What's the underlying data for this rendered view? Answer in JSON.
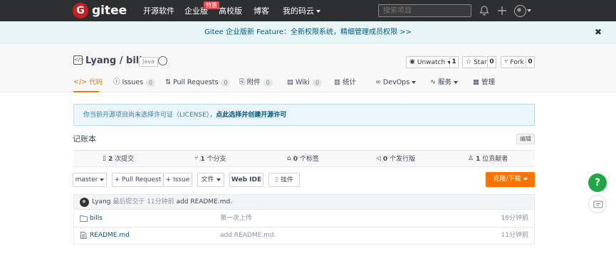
{
  "brand": {
    "logo_letter": "G",
    "name": "gitee"
  },
  "topnav": {
    "items": [
      "开源软件",
      "企业版",
      "高校版",
      "博客",
      "我的码云"
    ],
    "hot_badge": "特惠",
    "search_placeholder": "搜索项目"
  },
  "banner": {
    "text": "Gitee 企业版新 Feature：全新权限系统，精细管理成员权限 >>"
  },
  "repo": {
    "owner": "Lyang",
    "name": "bills",
    "title": "Lyang / bills",
    "language": "Java",
    "actions": [
      {
        "label": "Unwatch",
        "count": "1"
      },
      {
        "label": "Star",
        "count": "0"
      },
      {
        "label": "Fork",
        "count": "0"
      }
    ]
  },
  "tabs": [
    {
      "label": "代码",
      "count": null
    },
    {
      "label": "Issues",
      "count": "0"
    },
    {
      "label": "Pull Requests",
      "count": "0"
    },
    {
      "label": "附件",
      "count": "0"
    },
    {
      "label": "Wiki",
      "count": "0"
    },
    {
      "label": "统计",
      "count": null
    },
    {
      "label": "DevOps",
      "count": null
    },
    {
      "label": "服务",
      "count": null
    },
    {
      "label": "管理",
      "count": null
    }
  ],
  "license": {
    "text": "你当前开源项目尚未选择许可证（LICENSE），",
    "link": "点此选择并创建开源许可"
  },
  "description": "记账本",
  "edit_label": "编辑",
  "stats": [
    {
      "num": "2",
      "label": "次提交"
    },
    {
      "num": "1",
      "label": "个分支"
    },
    {
      "num": "0",
      "label": "个标签"
    },
    {
      "num": "0",
      "label": "个发行版"
    },
    {
      "num": "1",
      "label": "位贡献者"
    }
  ],
  "toolbar": {
    "branch": "master",
    "pull_request": "+ Pull Request",
    "issue": "+ Issue",
    "files": "文件",
    "web_ide": "Web IDE",
    "widget": "挂件",
    "clone": "克隆/下载"
  },
  "last_commit": {
    "author": "Lyang",
    "meta": "最后提交于 11分钟前",
    "message": "add README.md."
  },
  "files": [
    {
      "type": "folder",
      "name": "bills",
      "message": "第一次上传",
      "time": "18分钟前"
    },
    {
      "type": "file",
      "name": "README.md",
      "message": "add README.md.",
      "time": "11分钟前"
    }
  ],
  "colors": {
    "accent": "#fe7300",
    "topbar": "#2e2f31",
    "brand_red": "#c71d23",
    "help_green": "#1fa743"
  },
  "icons": [
    "bell-icon",
    "plus-icon",
    "close-icon",
    "eye-icon",
    "star-icon",
    "fork-icon",
    "folder-icon",
    "file-icon",
    "question-icon",
    "chat-icon"
  ]
}
